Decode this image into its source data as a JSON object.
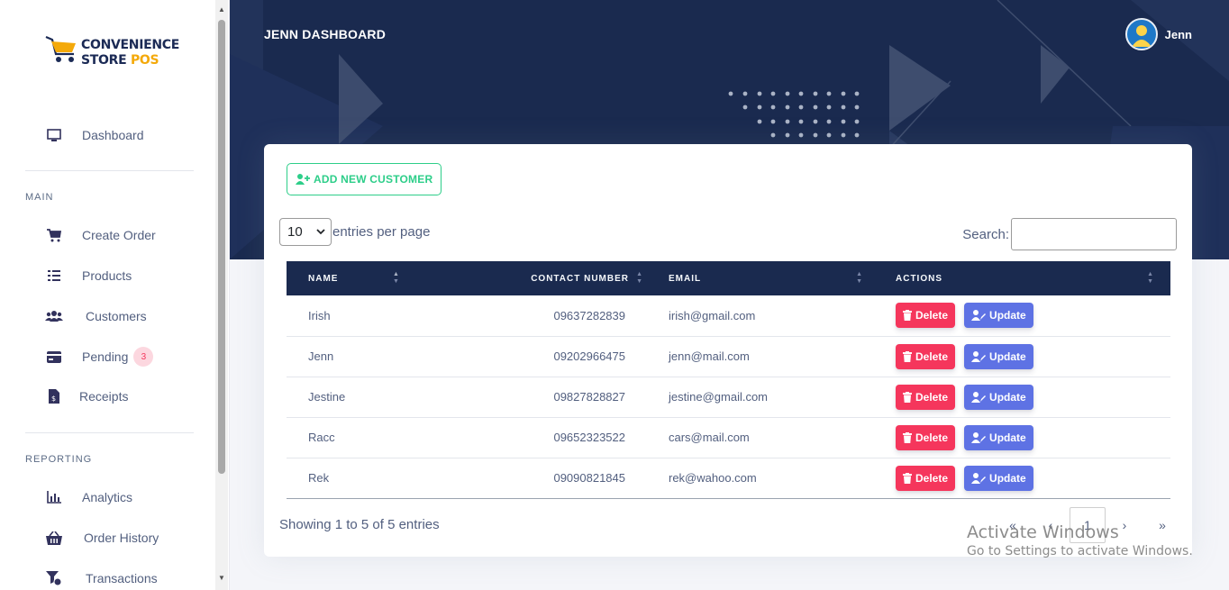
{
  "sidebar": {
    "logo": {
      "line1": "CONVENIENCE",
      "line2a": "STORE",
      "line2b": "POS"
    },
    "dashboard": "Dashboard",
    "main_title": "MAIN",
    "main_items": [
      {
        "label": "Create Order",
        "icon": "cart-icon"
      },
      {
        "label": "Products",
        "icon": "list-icon"
      },
      {
        "label": "Customers",
        "icon": "users-icon"
      },
      {
        "label": "Pending",
        "icon": "card-icon",
        "badge": "3"
      },
      {
        "label": "Receipts",
        "icon": "receipt-icon"
      }
    ],
    "reporting_title": "REPORTING",
    "reporting_items": [
      {
        "label": "Analytics",
        "icon": "chart-icon"
      },
      {
        "label": "Order History",
        "icon": "basket-icon"
      },
      {
        "label": "Transactions",
        "icon": "funnel-dollar-icon"
      }
    ]
  },
  "header": {
    "title": "JENN DASHBOARD",
    "user_name": "Jenn"
  },
  "card": {
    "add_button": "ADD NEW CUSTOMER",
    "entries_value": "10",
    "entries_label": "entries per page",
    "search_label": "Search:",
    "search_value": "",
    "columns": [
      "NAME",
      "CONTACT NUMBER",
      "EMAIL",
      "ACTIONS"
    ],
    "rows": [
      {
        "name": "Irish",
        "contact": "09637282839",
        "email": "irish@gmail.com"
      },
      {
        "name": "Jenn",
        "contact": "09202966475",
        "email": "jenn@mail.com"
      },
      {
        "name": "Jestine",
        "contact": "09827828827",
        "email": "jestine@gmail.com"
      },
      {
        "name": "Racc",
        "contact": "09652323522",
        "email": "cars@mail.com"
      },
      {
        "name": "Rek",
        "contact": "09090821845",
        "email": "rek@wahoo.com"
      }
    ],
    "delete_label": "Delete",
    "update_label": "Update",
    "showing": "Showing 1 to 5 of 5 entries",
    "pager": {
      "first": "«",
      "prev": "‹",
      "current": "1",
      "next": "›",
      "last": "»"
    }
  },
  "watermark": {
    "line1": "Activate Windows",
    "line2": "Go to Settings to activate Windows."
  },
  "colors": {
    "navy": "#1a2a4f",
    "green": "#2dce89",
    "red": "#f5365c",
    "indigo": "#5e72e4"
  }
}
